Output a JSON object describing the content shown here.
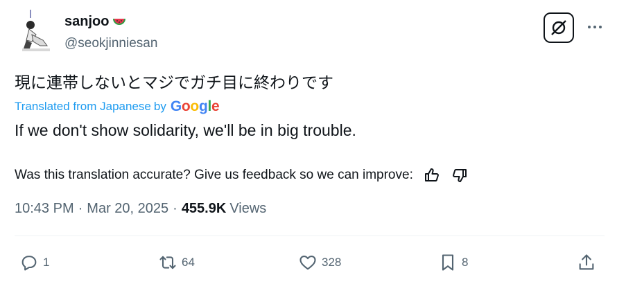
{
  "user": {
    "display_name": "sanjoo",
    "handle": "@seokjinniesan"
  },
  "icons": {
    "avatar": "avatar-figure-icon",
    "name_emoji": "watermelon-icon",
    "grok": "grok-icon",
    "more": "more-dots-icon",
    "thumb_up": "thumbs-up-icon",
    "thumb_down": "thumbs-down-icon",
    "reply": "reply-icon",
    "repost": "repost-icon",
    "like": "heart-icon",
    "bookmark": "bookmark-icon",
    "share": "share-icon"
  },
  "tweet": {
    "original_text": "現に連帯しないとマジでガチ目に終わりです",
    "translated_from": "Translated from Japanese",
    "by": "by",
    "translator": "Google",
    "translated_text": "If we don't show solidarity, we'll be in big trouble.",
    "feedback_prompt": "Was this translation accurate? Give us feedback so we can improve:",
    "time": "10:43 PM",
    "date": "Mar 20, 2025",
    "views_count": "455.9K",
    "views_label": "Views",
    "separator": "·"
  },
  "actions": {
    "replies": "1",
    "reposts": "64",
    "likes": "328",
    "bookmarks": "8"
  },
  "colors": {
    "accent": "#1d9bf0",
    "muted": "#536471",
    "text": "#0f1419",
    "google_blue": "#4285F4",
    "google_red": "#EA4335",
    "google_yellow": "#FBBC05",
    "google_green": "#34A853"
  }
}
